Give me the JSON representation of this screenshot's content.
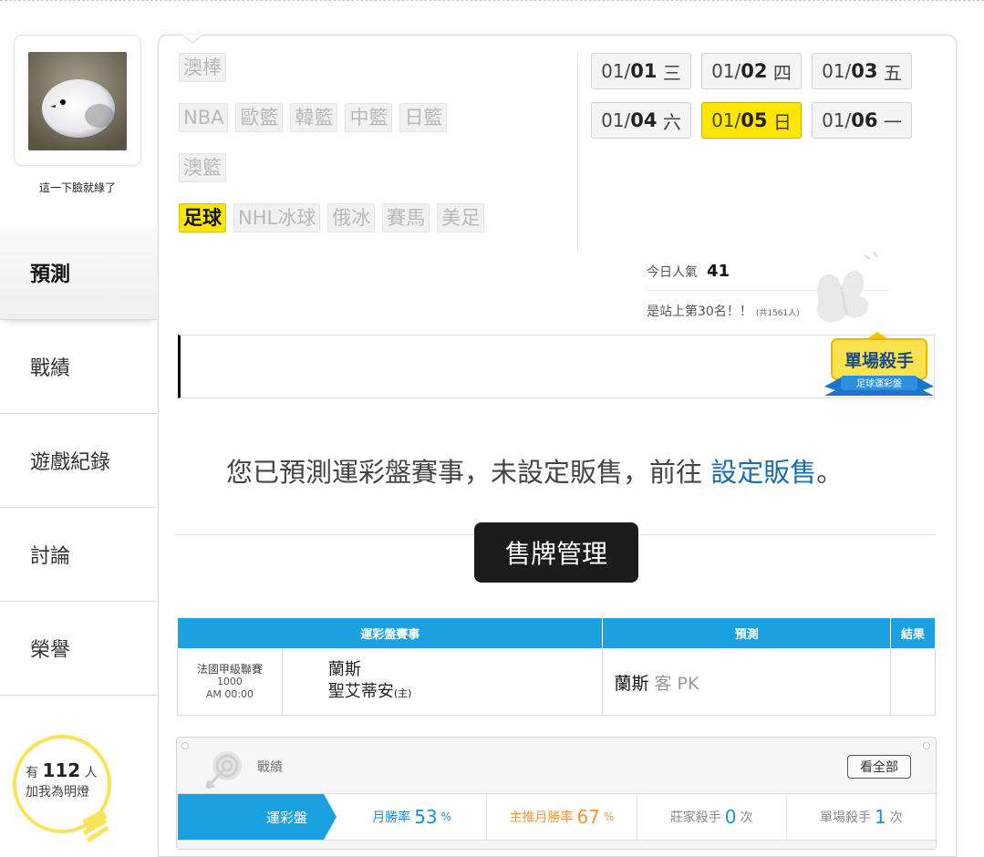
{
  "user": {
    "nickname": "這一下臉就綠了"
  },
  "left_nav": [
    {
      "label": "預測",
      "active": true
    },
    {
      "label": "戰績",
      "active": false
    },
    {
      "label": "遊戲紀錄",
      "active": false
    },
    {
      "label": "討論",
      "active": false
    },
    {
      "label": "榮譽",
      "active": false
    }
  ],
  "fans": {
    "prefix": "有",
    "count": "112",
    "unit": "人",
    "line2": "加我為明燈"
  },
  "sports": {
    "row1": [
      "澳棒"
    ],
    "row2": [
      "NBA",
      "歐籃",
      "韓籃",
      "中籃",
      "日籃"
    ],
    "row3": [
      "澳籃"
    ],
    "row4": [
      "足球",
      "NHL冰球",
      "俄冰",
      "賽馬",
      "美足"
    ],
    "active": "足球"
  },
  "dates": [
    {
      "month": "01/",
      "day": "01",
      "weekday": "三",
      "active": false
    },
    {
      "month": "01/",
      "day": "02",
      "weekday": "四",
      "active": false
    },
    {
      "month": "01/",
      "day": "03",
      "weekday": "五",
      "active": false
    },
    {
      "month": "01/",
      "day": "04",
      "weekday": "六",
      "active": false
    },
    {
      "month": "01/",
      "day": "05",
      "weekday": "日",
      "active": true
    },
    {
      "month": "01/",
      "day": "06",
      "weekday": "一",
      "active": false
    }
  ],
  "popularity": {
    "label": "今日人氣",
    "value": "41",
    "rank_text": "是站上第30名！！",
    "total": "(共1561人)"
  },
  "badge": {
    "title": "單場殺手",
    "subtitle": "足球運彩盤"
  },
  "notice": {
    "text": "您已預測運彩盤賽事，未設定販售，前往 ",
    "link": "設定販售",
    "end": "。"
  },
  "sell_button": "售牌管理",
  "table": {
    "headers": [
      "運彩盤賽事",
      "預測",
      "結果"
    ],
    "rows": [
      {
        "league": "法國甲級聯賽",
        "game_no": "1000",
        "time": "AM 00:00",
        "away": "蘭斯",
        "home": "聖艾蒂安",
        "home_tag": "(主)",
        "pick_team": "蘭斯",
        "pick_detail": "客 PK",
        "result": ""
      }
    ]
  },
  "stats": {
    "title": "戰績",
    "see_all": "看全部",
    "tab": "運彩盤",
    "items": [
      {
        "label": "月勝率",
        "value": "53",
        "unit": "%",
        "color": "#1b8fd6"
      },
      {
        "label": "主推月勝率",
        "value": "67",
        "unit": "%",
        "color": "#f2953a"
      },
      {
        "label": "莊家殺手",
        "value": "0",
        "unit": "次",
        "color": "#1b8fd6"
      },
      {
        "label": "單場殺手",
        "value": "1",
        "unit": "次",
        "color": "#1b8fd6"
      }
    ]
  }
}
